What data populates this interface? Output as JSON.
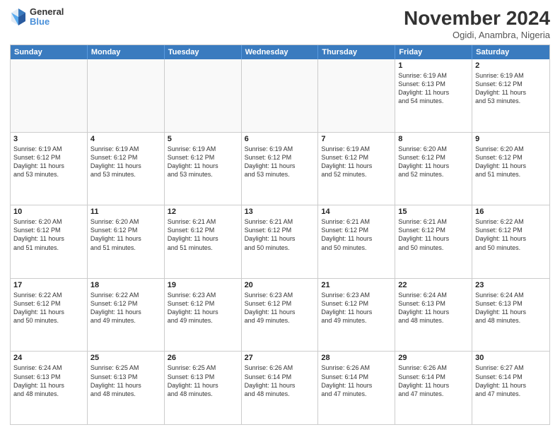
{
  "logo": {
    "general": "General",
    "blue": "Blue"
  },
  "title": "November 2024",
  "location": "Ogidi, Anambra, Nigeria",
  "days": [
    "Sunday",
    "Monday",
    "Tuesday",
    "Wednesday",
    "Thursday",
    "Friday",
    "Saturday"
  ],
  "rows": [
    [
      {
        "day": "",
        "detail": "",
        "empty": true
      },
      {
        "day": "",
        "detail": "",
        "empty": true
      },
      {
        "day": "",
        "detail": "",
        "empty": true
      },
      {
        "day": "",
        "detail": "",
        "empty": true
      },
      {
        "day": "",
        "detail": "",
        "empty": true
      },
      {
        "day": "1",
        "detail": "Sunrise: 6:19 AM\nSunset: 6:13 PM\nDaylight: 11 hours\nand 54 minutes."
      },
      {
        "day": "2",
        "detail": "Sunrise: 6:19 AM\nSunset: 6:12 PM\nDaylight: 11 hours\nand 53 minutes."
      }
    ],
    [
      {
        "day": "3",
        "detail": "Sunrise: 6:19 AM\nSunset: 6:12 PM\nDaylight: 11 hours\nand 53 minutes."
      },
      {
        "day": "4",
        "detail": "Sunrise: 6:19 AM\nSunset: 6:12 PM\nDaylight: 11 hours\nand 53 minutes."
      },
      {
        "day": "5",
        "detail": "Sunrise: 6:19 AM\nSunset: 6:12 PM\nDaylight: 11 hours\nand 53 minutes."
      },
      {
        "day": "6",
        "detail": "Sunrise: 6:19 AM\nSunset: 6:12 PM\nDaylight: 11 hours\nand 53 minutes."
      },
      {
        "day": "7",
        "detail": "Sunrise: 6:19 AM\nSunset: 6:12 PM\nDaylight: 11 hours\nand 52 minutes."
      },
      {
        "day": "8",
        "detail": "Sunrise: 6:20 AM\nSunset: 6:12 PM\nDaylight: 11 hours\nand 52 minutes."
      },
      {
        "day": "9",
        "detail": "Sunrise: 6:20 AM\nSunset: 6:12 PM\nDaylight: 11 hours\nand 51 minutes."
      }
    ],
    [
      {
        "day": "10",
        "detail": "Sunrise: 6:20 AM\nSunset: 6:12 PM\nDaylight: 11 hours\nand 51 minutes."
      },
      {
        "day": "11",
        "detail": "Sunrise: 6:20 AM\nSunset: 6:12 PM\nDaylight: 11 hours\nand 51 minutes."
      },
      {
        "day": "12",
        "detail": "Sunrise: 6:21 AM\nSunset: 6:12 PM\nDaylight: 11 hours\nand 51 minutes."
      },
      {
        "day": "13",
        "detail": "Sunrise: 6:21 AM\nSunset: 6:12 PM\nDaylight: 11 hours\nand 50 minutes."
      },
      {
        "day": "14",
        "detail": "Sunrise: 6:21 AM\nSunset: 6:12 PM\nDaylight: 11 hours\nand 50 minutes."
      },
      {
        "day": "15",
        "detail": "Sunrise: 6:21 AM\nSunset: 6:12 PM\nDaylight: 11 hours\nand 50 minutes."
      },
      {
        "day": "16",
        "detail": "Sunrise: 6:22 AM\nSunset: 6:12 PM\nDaylight: 11 hours\nand 50 minutes."
      }
    ],
    [
      {
        "day": "17",
        "detail": "Sunrise: 6:22 AM\nSunset: 6:12 PM\nDaylight: 11 hours\nand 50 minutes."
      },
      {
        "day": "18",
        "detail": "Sunrise: 6:22 AM\nSunset: 6:12 PM\nDaylight: 11 hours\nand 49 minutes."
      },
      {
        "day": "19",
        "detail": "Sunrise: 6:23 AM\nSunset: 6:12 PM\nDaylight: 11 hours\nand 49 minutes."
      },
      {
        "day": "20",
        "detail": "Sunrise: 6:23 AM\nSunset: 6:12 PM\nDaylight: 11 hours\nand 49 minutes."
      },
      {
        "day": "21",
        "detail": "Sunrise: 6:23 AM\nSunset: 6:12 PM\nDaylight: 11 hours\nand 49 minutes."
      },
      {
        "day": "22",
        "detail": "Sunrise: 6:24 AM\nSunset: 6:13 PM\nDaylight: 11 hours\nand 48 minutes."
      },
      {
        "day": "23",
        "detail": "Sunrise: 6:24 AM\nSunset: 6:13 PM\nDaylight: 11 hours\nand 48 minutes."
      }
    ],
    [
      {
        "day": "24",
        "detail": "Sunrise: 6:24 AM\nSunset: 6:13 PM\nDaylight: 11 hours\nand 48 minutes."
      },
      {
        "day": "25",
        "detail": "Sunrise: 6:25 AM\nSunset: 6:13 PM\nDaylight: 11 hours\nand 48 minutes."
      },
      {
        "day": "26",
        "detail": "Sunrise: 6:25 AM\nSunset: 6:13 PM\nDaylight: 11 hours\nand 48 minutes."
      },
      {
        "day": "27",
        "detail": "Sunrise: 6:26 AM\nSunset: 6:14 PM\nDaylight: 11 hours\nand 48 minutes."
      },
      {
        "day": "28",
        "detail": "Sunrise: 6:26 AM\nSunset: 6:14 PM\nDaylight: 11 hours\nand 47 minutes."
      },
      {
        "day": "29",
        "detail": "Sunrise: 6:26 AM\nSunset: 6:14 PM\nDaylight: 11 hours\nand 47 minutes."
      },
      {
        "day": "30",
        "detail": "Sunrise: 6:27 AM\nSunset: 6:14 PM\nDaylight: 11 hours\nand 47 minutes."
      }
    ]
  ]
}
